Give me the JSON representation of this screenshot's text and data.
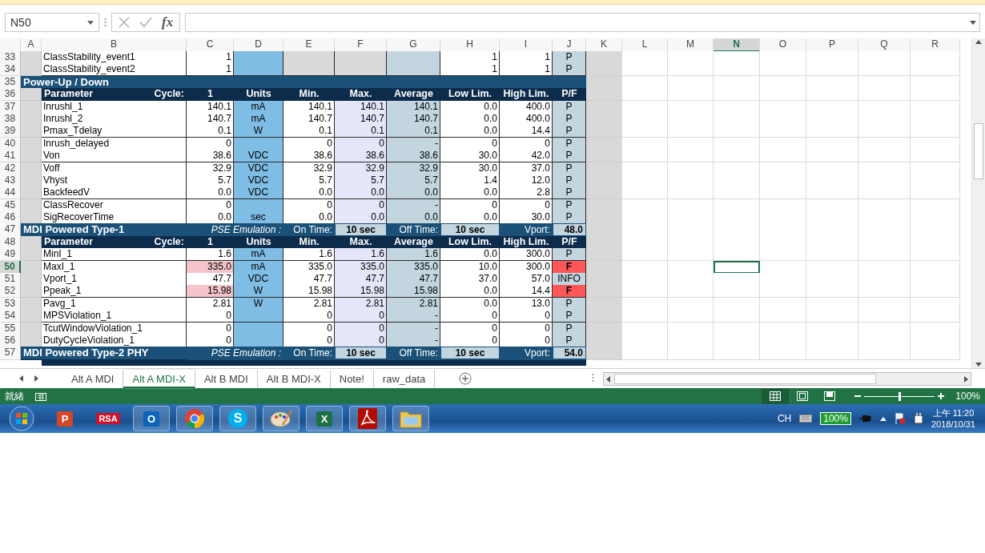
{
  "formula_bar": {
    "name_box": "N50",
    "function_button": "fx"
  },
  "columns": [
    {
      "letter": "A",
      "selected": false
    },
    {
      "letter": "B",
      "selected": false
    },
    {
      "letter": "C",
      "selected": false
    },
    {
      "letter": "D",
      "selected": false
    },
    {
      "letter": "E",
      "selected": false
    },
    {
      "letter": "F",
      "selected": false
    },
    {
      "letter": "G",
      "selected": false
    },
    {
      "letter": "H",
      "selected": false
    },
    {
      "letter": "I",
      "selected": false
    },
    {
      "letter": "J",
      "selected": false
    },
    {
      "letter": "K",
      "selected": false
    },
    {
      "letter": "L",
      "selected": false
    },
    {
      "letter": "M",
      "selected": false
    },
    {
      "letter": "N",
      "selected": true
    },
    {
      "letter": "O",
      "selected": false
    },
    {
      "letter": "P",
      "selected": false
    },
    {
      "letter": "Q",
      "selected": false
    },
    {
      "letter": "R",
      "selected": false
    }
  ],
  "rows": [
    {
      "kind": "class",
      "number": "33",
      "selected": false,
      "fail": false,
      "cells": {
        "parameter": "ClassStability_event1",
        "value": "1",
        "low_lim": "1",
        "high_lim": "1",
        "pf": "P"
      }
    },
    {
      "kind": "class",
      "number": "34",
      "selected": false,
      "fail": false,
      "cells": {
        "parameter": "ClassStability_event2",
        "value": "1",
        "low_lim": "1",
        "high_lim": "1",
        "pf": "P"
      }
    },
    {
      "kind": "section",
      "number": "35",
      "selected": false,
      "title": "Power-Up / Down"
    },
    {
      "kind": "header",
      "number": "36",
      "selected": false,
      "labels": {
        "parameter": "Parameter",
        "cycle_label": "Cycle:",
        "value": "1",
        "units": "Units",
        "min": "Min.",
        "max": "Max.",
        "average": "Average",
        "low_lim": "Low Lim.",
        "high_lim": "High Lim.",
        "pf": "P/F"
      }
    },
    {
      "kind": "measure",
      "number": "37",
      "selected": false,
      "fail": false,
      "cells": {
        "parameter": "Inrushl_1",
        "value": "140.1",
        "units": "mA",
        "min": "140.1",
        "max": "140.1",
        "average": "140.1",
        "low_lim": "0.0",
        "high_lim": "400.0",
        "pf": "P"
      }
    },
    {
      "kind": "measure",
      "number": "38",
      "selected": false,
      "fail": false,
      "cells": {
        "parameter": "Inrushl_2",
        "value": "140.7",
        "units": "mA",
        "min": "140.7",
        "max": "140.7",
        "average": "140.7",
        "low_lim": "0.0",
        "high_lim": "400.0",
        "pf": "P"
      }
    },
    {
      "kind": "measure",
      "number": "39",
      "selected": false,
      "fail": false,
      "cells": {
        "parameter": "Pmax_Tdelay",
        "value": "0.1",
        "units": "W",
        "min": "0.1",
        "max": "0.1",
        "average": "0.1",
        "low_lim": "0.0",
        "high_lim": "14.4",
        "pf": "P"
      }
    },
    {
      "kind": "measure",
      "number": "40",
      "selected": false,
      "fail": false,
      "cells": {
        "parameter": "Inrush_delayed",
        "value": "0",
        "min": "0",
        "max": "0",
        "average": "-",
        "low_lim": "0",
        "high_lim": "0",
        "pf": "P"
      }
    },
    {
      "kind": "measure",
      "number": "41",
      "selected": false,
      "fail": false,
      "cells": {
        "parameter": "Von",
        "value": "38.6",
        "units": "VDC",
        "min": "38.6",
        "max": "38.6",
        "average": "38.6",
        "low_lim": "30.0",
        "high_lim": "42.0",
        "pf": "P"
      }
    },
    {
      "kind": "measure",
      "number": "42",
      "selected": false,
      "fail": false,
      "cells": {
        "parameter": "Voff",
        "value": "32.9",
        "units": "VDC",
        "min": "32.9",
        "max": "32.9",
        "average": "32.9",
        "low_lim": "30.0",
        "high_lim": "37.0",
        "pf": "P"
      }
    },
    {
      "kind": "measure",
      "number": "43",
      "selected": false,
      "fail": false,
      "cells": {
        "parameter": "Vhyst",
        "value": "5.7",
        "units": "VDC",
        "min": "5.7",
        "max": "5.7",
        "average": "5.7",
        "low_lim": "1.4",
        "high_lim": "12.0",
        "pf": "P"
      }
    },
    {
      "kind": "measure",
      "number": "44",
      "selected": false,
      "fail": false,
      "cells": {
        "parameter": "BackfeedV",
        "value": "0.0",
        "units": "VDC",
        "min": "0.0",
        "max": "0.0",
        "average": "0.0",
        "low_lim": "0.0",
        "high_lim": "2.8",
        "pf": "P"
      }
    },
    {
      "kind": "measure",
      "number": "45",
      "selected": false,
      "fail": false,
      "cells": {
        "parameter": "ClassRecover",
        "value": "0",
        "min": "0",
        "max": "0",
        "average": "-",
        "low_lim": "0",
        "high_lim": "0",
        "pf": "P"
      }
    },
    {
      "kind": "measure",
      "number": "46",
      "selected": false,
      "fail": false,
      "cells": {
        "parameter": "SigRecoverTime",
        "value": "0.0",
        "units": "sec",
        "min": "0.0",
        "max": "0.0",
        "average": "0.0",
        "low_lim": "0.0",
        "high_lim": "30.0",
        "pf": "P"
      }
    },
    {
      "kind": "section",
      "number": "47",
      "selected": false,
      "title": "MDI Powered Type-1",
      "emulation": {
        "label": "PSE Emulation :",
        "on_label": "On Time:",
        "on_value": "10 sec",
        "off_label": "Off Time:",
        "off_value": "10 sec",
        "vport_label": "Vport:",
        "vport_value": "48.0"
      }
    },
    {
      "kind": "header",
      "number": "48",
      "selected": false,
      "labels": {
        "parameter": "Parameter",
        "cycle_label": "Cycle:",
        "value": "1",
        "units": "Units",
        "min": "Min.",
        "max": "Max.",
        "average": "Average",
        "low_lim": "Low Lim.",
        "high_lim": "High Lim.",
        "pf": "P/F"
      }
    },
    {
      "kind": "measure",
      "number": "49",
      "selected": false,
      "fail": false,
      "cells": {
        "parameter": "MinI_1",
        "value": "1.6",
        "units": "mA",
        "min": "1.6",
        "max": "1.6",
        "average": "1.6",
        "low_lim": "0.0",
        "high_lim": "300.0",
        "pf": "P"
      }
    },
    {
      "kind": "measure",
      "number": "50",
      "selected": true,
      "fail": true,
      "cells": {
        "parameter": "MaxI_1",
        "value": "335.0",
        "units": "mA",
        "min": "335.0",
        "max": "335.0",
        "average": "335.0",
        "low_lim": "10.0",
        "high_lim": "300.0",
        "pf": "F"
      }
    },
    {
      "kind": "measure",
      "number": "51",
      "selected": false,
      "fail": false,
      "cells": {
        "parameter": "Vport_1",
        "value": "47.7",
        "units": "VDC",
        "min": "47.7",
        "max": "47.7",
        "average": "47.7",
        "low_lim": "37.0",
        "high_lim": "57.0",
        "pf": "INFO"
      }
    },
    {
      "kind": "measure",
      "number": "52",
      "selected": false,
      "fail": true,
      "cells": {
        "parameter": "Ppeak_1",
        "value": "15.98",
        "units": "W",
        "min": "15.98",
        "max": "15.98",
        "average": "15.98",
        "low_lim": "0.0",
        "high_lim": "14.4",
        "pf": "F"
      }
    },
    {
      "kind": "measure",
      "number": "53",
      "selected": false,
      "fail": false,
      "cells": {
        "parameter": "Pavg_1",
        "value": "2.81",
        "units": "W",
        "min": "2.81",
        "max": "2.81",
        "average": "2.81",
        "low_lim": "0.0",
        "high_lim": "13.0",
        "pf": "P"
      }
    },
    {
      "kind": "measure",
      "number": "54",
      "selected": false,
      "fail": false,
      "cells": {
        "parameter": "MPSViolation_1",
        "value": "0",
        "min": "0",
        "max": "0",
        "average": "-",
        "low_lim": "0",
        "high_lim": "0",
        "pf": "P"
      }
    },
    {
      "kind": "measure",
      "number": "55",
      "selected": false,
      "fail": false,
      "cells": {
        "parameter": "TcutWindowViolation_1",
        "value": "0",
        "min": "0",
        "max": "0",
        "average": "-",
        "low_lim": "0",
        "high_lim": "0",
        "pf": "P"
      }
    },
    {
      "kind": "measure",
      "number": "56",
      "selected": false,
      "fail": false,
      "cells": {
        "parameter": "DutyCycleViolation_1",
        "value": "0",
        "min": "0",
        "max": "0",
        "average": "-",
        "low_lim": "0",
        "high_lim": "0",
        "pf": "P"
      }
    },
    {
      "kind": "section",
      "number": "57",
      "selected": false,
      "title": "MDI Powered Type-2 PHY",
      "emulation": {
        "label": "PSE Emulation :",
        "on_label": "On Time:",
        "on_value": "10 sec",
        "off_label": "Off Time:",
        "off_value": "10 sec",
        "vport_label": "Vport:",
        "vport_value": "54.0"
      }
    }
  ],
  "sheet_tabs": [
    {
      "label": "Alt A MDI",
      "selected": false
    },
    {
      "label": "Alt A MDI-X",
      "selected": true
    },
    {
      "label": "Alt B MDI",
      "selected": false
    },
    {
      "label": "Alt B MDI-X",
      "selected": false
    },
    {
      "label": "Note!",
      "selected": false
    },
    {
      "label": "raw_data",
      "selected": false
    }
  ],
  "status_bar": {
    "status": "就緒",
    "views": [
      {
        "kind": "normal",
        "selected": true
      },
      {
        "kind": "page_layout",
        "selected": false
      },
      {
        "kind": "page_break",
        "selected": false
      }
    ],
    "zoom": {
      "level": 0.5,
      "reading": "100%"
    }
  },
  "taskbar": {
    "items": [
      {
        "kind": "start",
        "open": false
      },
      {
        "kind": "powerpoint",
        "label": "P",
        "open": false
      },
      {
        "kind": "rsa",
        "label": "RSA",
        "open": false
      },
      {
        "kind": "outlook",
        "label": "O",
        "open": true
      },
      {
        "kind": "chrome",
        "open": true
      },
      {
        "kind": "skype",
        "label": "S",
        "open": true
      },
      {
        "kind": "paint",
        "open": true
      },
      {
        "kind": "excel",
        "label": "X",
        "open": true
      },
      {
        "kind": "acrobat",
        "open": true
      },
      {
        "kind": "explorer",
        "open": true
      }
    ],
    "language": "CH",
    "battery": "100%",
    "time": "上午 11:20",
    "date": "2018/10/31"
  }
}
